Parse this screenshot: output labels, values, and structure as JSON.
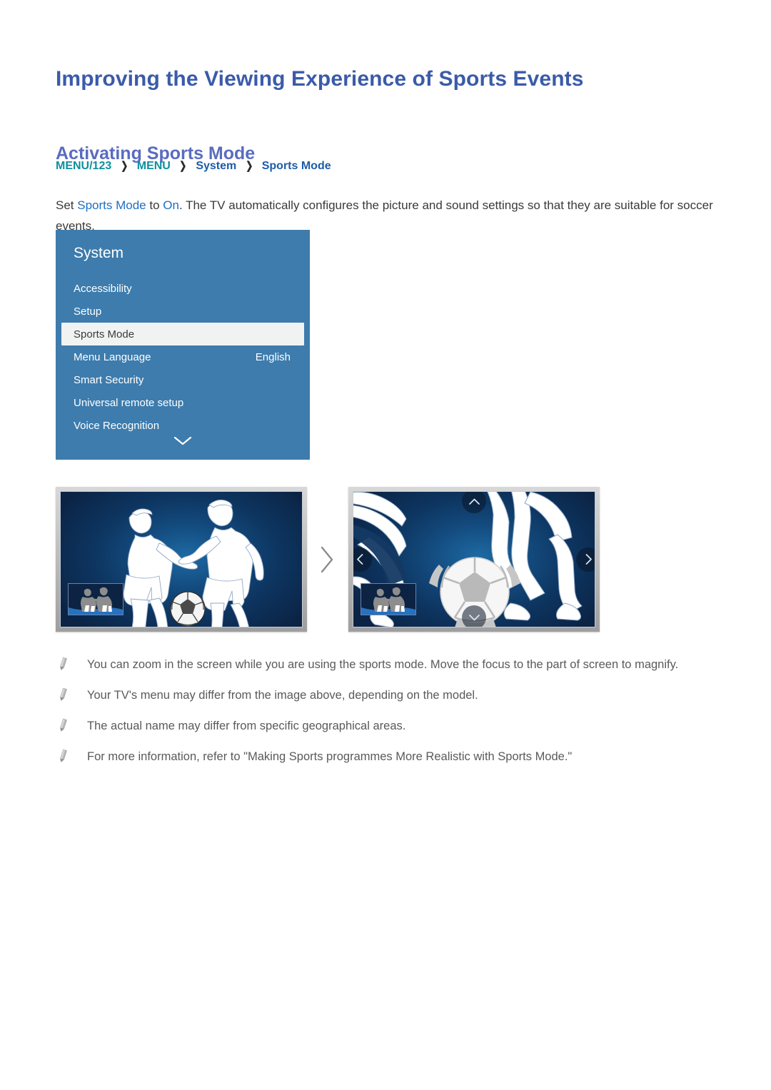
{
  "document": {
    "title": "Improving the Viewing Experience of Sports Events",
    "section_title": "Activating Sports Mode"
  },
  "breadcrumb": {
    "separator": "❯",
    "items": [
      {
        "label": "MENU/123",
        "style": "teal"
      },
      {
        "label": "MENU",
        "style": "teal"
      },
      {
        "label": "System",
        "style": "blue"
      },
      {
        "label": "Sports Mode",
        "style": "blue"
      }
    ]
  },
  "body": {
    "para_1": "Set ",
    "para_highlight_1": "Sports Mode",
    "para_2": " to ",
    "para_highlight_2": "On",
    "para_3": ". The TV automatically configures the picture and sound settings so that they are suitable for soccer events."
  },
  "tv_menu": {
    "title": "System",
    "rows": [
      {
        "label": "Accessibility",
        "value": "",
        "selected": false
      },
      {
        "label": "Setup",
        "value": "",
        "selected": false
      },
      {
        "label": "Sports Mode",
        "value": "",
        "selected": true
      },
      {
        "label": "Menu Language",
        "value": "English",
        "selected": false
      },
      {
        "label": "Smart Security",
        "value": "",
        "selected": false
      },
      {
        "label": "Universal remote setup",
        "value": "",
        "selected": false
      },
      {
        "label": "Voice Recognition",
        "value": "",
        "selected": false
      }
    ],
    "scroll_icon": "chevron-down-icon",
    "colors": {
      "panel_bg": "#3d7cad",
      "selected_bg": "#f1f2f2",
      "text": "#ffffff",
      "selected_text": "#3b3b3b"
    }
  },
  "illustrations": {
    "separator_icon": "chevron-right-icon",
    "left_tv": {
      "caption": "",
      "pip_label": "picture-in-picture-thumbnail",
      "screen_content": "two-soccer-players-line-art"
    },
    "right_tv": {
      "caption": "",
      "pip_label": "picture-in-picture-thumbnail",
      "screen_content": "zoomed-soccer-players-with-ball",
      "nav_buttons": [
        "chevron-up-icon",
        "chevron-down-icon",
        "chevron-left-icon",
        "chevron-right-icon"
      ]
    }
  },
  "notes": {
    "icon": "pencil-icon",
    "items": [
      "You can zoom in the screen while you are using the sports mode. Move the focus to the part of screen to magnify.",
      "Your TV's menu may differ from the image above, depending on the model.",
      "The actual name may differ from specific geographical areas.",
      "For more information, refer to \"Making Sports programmes More Realistic with Sports Mode.\""
    ]
  },
  "colors": {
    "title": "#3b5ba9",
    "section_title": "#5a6cc0",
    "teal": "#0d8f9f",
    "blue": "#1c5ca8",
    "body_text": "#3a3a3a",
    "note_text": "#5a5a5a",
    "page_bg": "#ffffff"
  }
}
